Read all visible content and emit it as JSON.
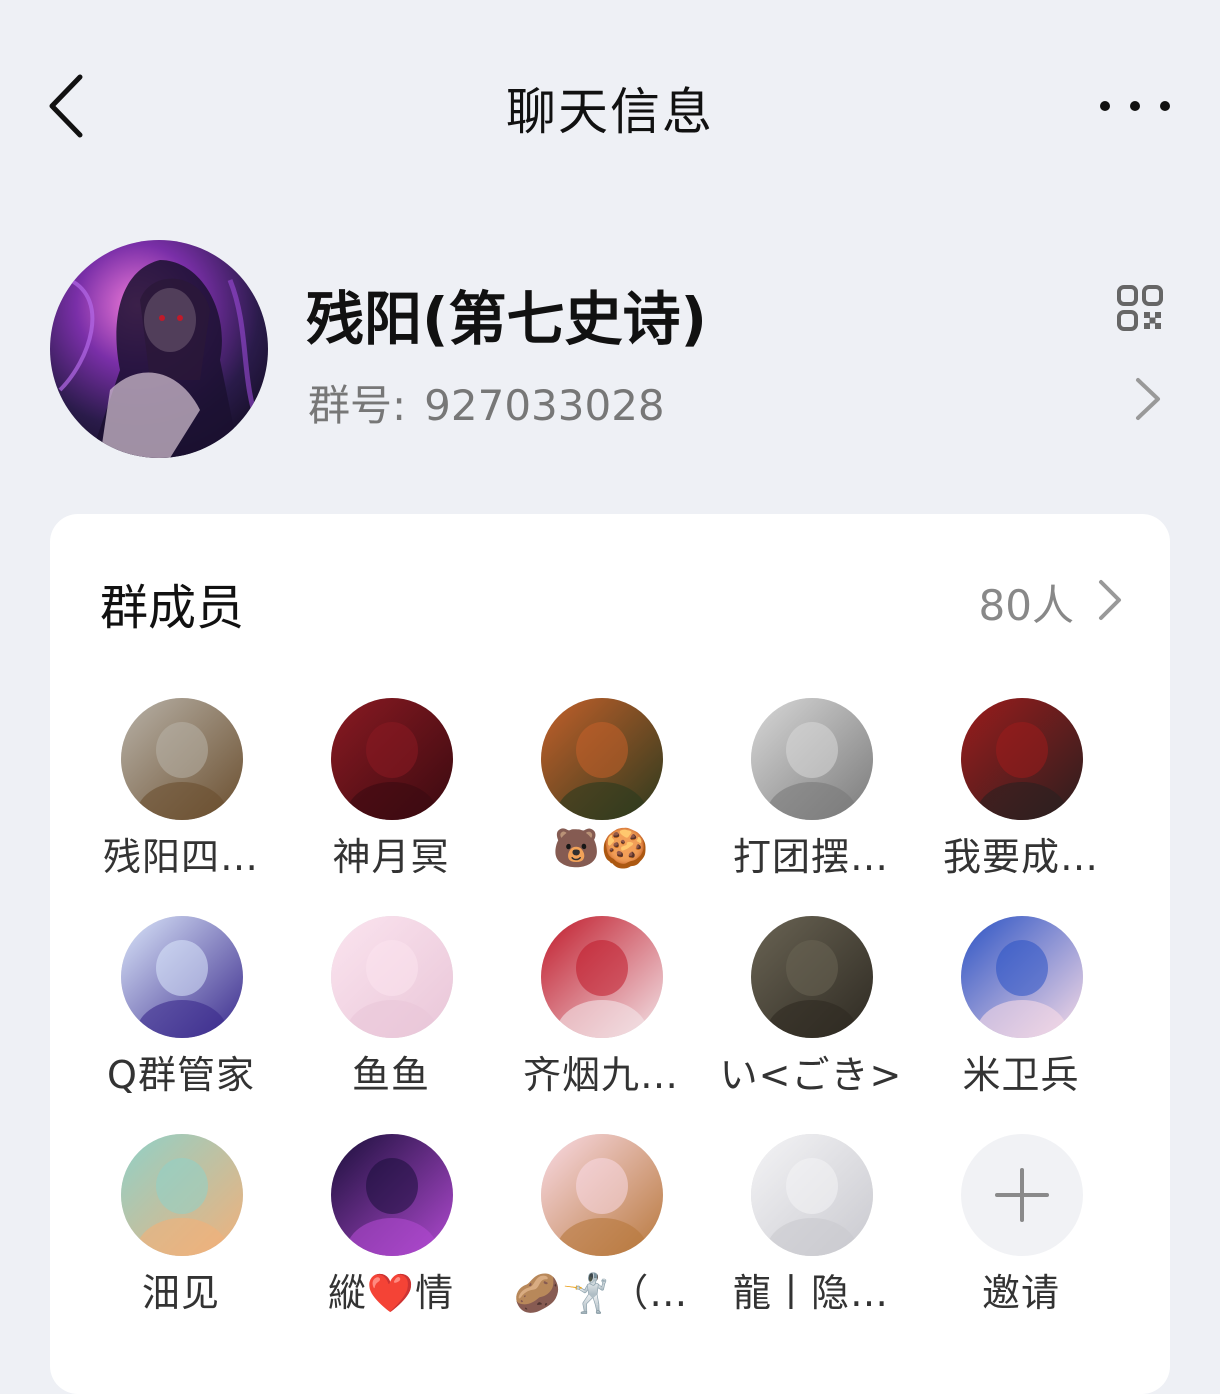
{
  "navbar": {
    "title": "聊天信息",
    "back_icon": "chevron-left-icon",
    "more_icon": "more-dots-icon"
  },
  "group": {
    "name": "残阳(第七史诗)",
    "id_label": "群号:",
    "id_value": "927033028",
    "qr_icon": "qr-code-icon"
  },
  "members": {
    "title": "群成员",
    "count": "80人",
    "list": [
      {
        "name": "残阳四…",
        "avatar": "toy-horse-avatar",
        "colors": [
          "#b8b2a8",
          "#6b4f2f"
        ]
      },
      {
        "name": "神月冥",
        "avatar": "red-eye-anime-avatar",
        "colors": [
          "#8a1a22",
          "#3a0a10"
        ]
      },
      {
        "name": "🐻🍪",
        "avatar": "red-panda-avatar",
        "colors": [
          "#c4602a",
          "#2c3a1e"
        ]
      },
      {
        "name": "打团摆…",
        "avatar": "sketch-anime-avatar",
        "colors": [
          "#d8d8d8",
          "#7a7a7a"
        ]
      },
      {
        "name": "我要成…",
        "avatar": "official-portrait-avatar",
        "colors": [
          "#9c1c1c",
          "#2a1f1f"
        ]
      },
      {
        "name": "Q群管家",
        "avatar": "robot-avatar",
        "colors": [
          "#dbe7fb",
          "#3a2a8c"
        ]
      },
      {
        "name": "鱼鱼",
        "avatar": "pink-anime-avatar",
        "colors": [
          "#fbe4ef",
          "#e9c6d8"
        ]
      },
      {
        "name": "齐烟九…",
        "avatar": "gothic-anime-avatar",
        "colors": [
          "#c01a2a",
          "#f3e4e8"
        ]
      },
      {
        "name": "い<ごき>",
        "avatar": "hands-photo-avatar",
        "colors": [
          "#6a6454",
          "#2e2a22"
        ]
      },
      {
        "name": "米卫兵",
        "avatar": "blue-hair-anime-avatar",
        "colors": [
          "#2a52c4",
          "#f7dbe6"
        ]
      },
      {
        "name": "沺见",
        "avatar": "smiling-pirate-avatar",
        "colors": [
          "#8fd1c8",
          "#f2b07a"
        ]
      },
      {
        "name": "縱❤️情",
        "avatar": "ferris-wheel-avatar",
        "colors": [
          "#1a0f3a",
          "#b04ad0"
        ]
      },
      {
        "name": "🥔🤺（…",
        "avatar": "bear-cake-avatar",
        "colors": [
          "#fadbe6",
          "#b8783c"
        ]
      },
      {
        "name": "龍丨隐…",
        "avatar": "white-dress-anime-avatar",
        "colors": [
          "#f4f4f6",
          "#c9c9cf"
        ]
      },
      {
        "name": "邀请",
        "avatar": "plus-icon",
        "colors": [
          "#f1f2f5",
          "#8a8a8a"
        ]
      }
    ]
  },
  "colors": {
    "background": "#eef0f5",
    "card": "#ffffff",
    "text_primary": "#111111",
    "text_secondary": "#777777"
  }
}
